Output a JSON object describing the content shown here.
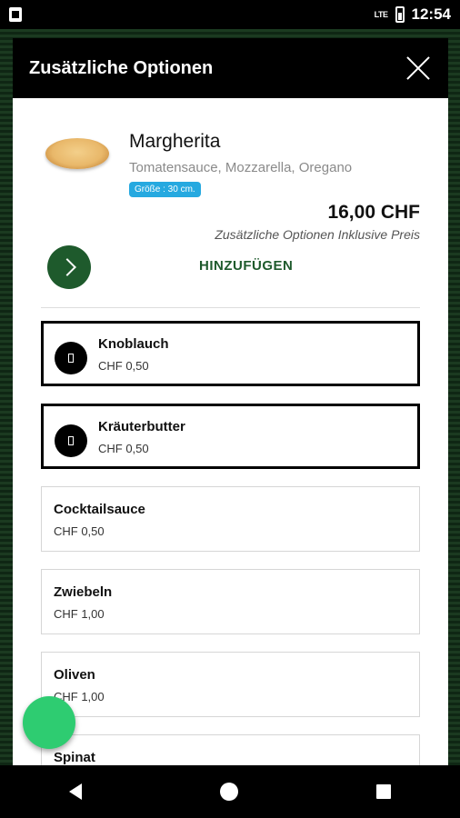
{
  "status_bar": {
    "time": "12:54",
    "network": "LTE"
  },
  "modal": {
    "title": "Zusätzliche Optionen",
    "product": {
      "name": "Margherita",
      "description": "Tomatensauce, Mozzarella, Oregano",
      "size_badge": "Größe : 30 cm.",
      "price": "16,00 CHF",
      "price_note": "Zusätzliche Optionen Inklusive Preis",
      "add_label": "HINZUFÜGEN"
    },
    "options": [
      {
        "name": "Knoblauch",
        "price": "CHF 0,50",
        "selected": true
      },
      {
        "name": "Kräuterbutter",
        "price": "CHF 0,50",
        "selected": true
      },
      {
        "name": "Cocktailsauce",
        "price": "CHF 0,50",
        "selected": false
      },
      {
        "name": "Zwiebeln",
        "price": "CHF 1,00",
        "selected": false
      },
      {
        "name": "Oliven",
        "price": "CHF 1,00",
        "selected": false
      },
      {
        "name": "Spinat",
        "price": "",
        "selected": false
      }
    ]
  },
  "colors": {
    "accent": "#1e5a2c",
    "badge": "#26a9e0",
    "fab": "#2ecc71"
  }
}
